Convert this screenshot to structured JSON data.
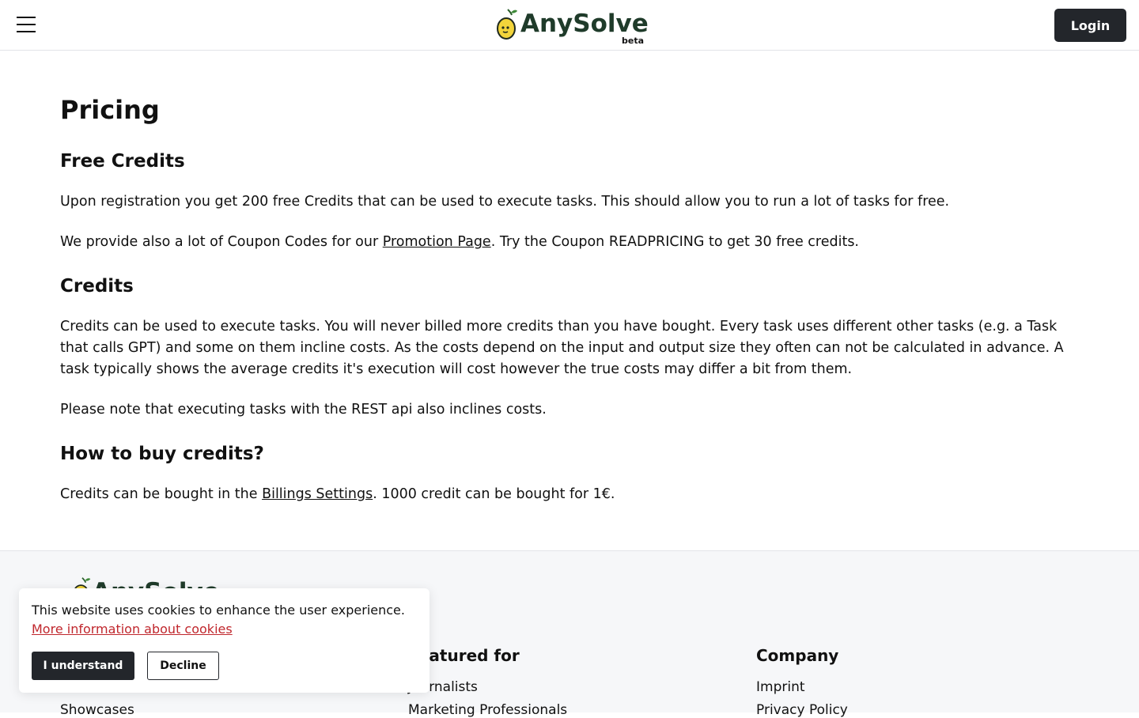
{
  "header": {
    "brand": "AnySolve",
    "badge": "beta",
    "login_label": "Login"
  },
  "page": {
    "title": "Pricing",
    "sections": [
      {
        "heading": "Free Credits",
        "p1": "Upon registration you get 200 free Credits that can be used to execute tasks. This should allow you to run a lot of tasks for free.",
        "p2_before": "We provide also a lot of Coupon Codes for our ",
        "p2_link": "Promotion Page",
        "p2_after": ". Try the Coupon READPRICING to get 30 free credits."
      },
      {
        "heading": "Credits",
        "p1": "Credits can be used to execute tasks. You will never billed more credits than you have bought. Every task uses different other tasks (e.g. a Task that calls GPT) and some on them incline costs. As the costs depend on the input and output size they often can not be calculated in advance. A task typically shows the average credits it's execution will cost however the true costs may differ a bit from them.",
        "p2": "Please note that executing tasks with the REST api also inclines costs."
      },
      {
        "heading": "How to buy credits?",
        "p1_before": "Credits can be bought in the ",
        "p1_link": "Billings Settings",
        "p1_after": ". 1000 credit can be bought for 1€."
      }
    ]
  },
  "footer": {
    "brand": "AnySolve",
    "columns": [
      {
        "heading": "",
        "links": [
          "Showcases"
        ]
      },
      {
        "heading": "Featured for",
        "links": [
          "Journalists",
          "Marketing Professionals"
        ]
      },
      {
        "heading": "Company",
        "links": [
          "Imprint",
          "Privacy Policy"
        ]
      }
    ]
  },
  "cookie_banner": {
    "message": "This website uses cookies to enhance the user experience.",
    "more_link": "More information about cookies",
    "accept_label": "I understand",
    "decline_label": "Decline"
  },
  "colors": {
    "brand_green": "#1f3b2a",
    "dark_button": "#23262b",
    "link_red": "#c0272d",
    "footer_bg": "#f6f7f9",
    "lemon": "#f2d43b"
  },
  "icons": [
    "menu-icon",
    "lemon-logo-icon"
  ]
}
